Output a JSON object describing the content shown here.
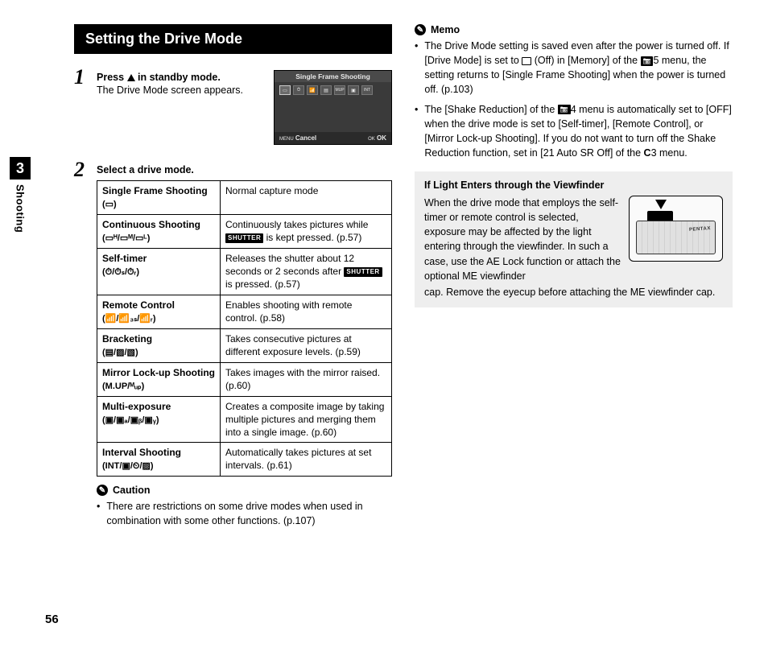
{
  "chapter": {
    "number": "3",
    "label": "Shooting"
  },
  "page_number": "56",
  "section_title": "Setting the Drive Mode",
  "steps": {
    "s1": {
      "num": "1",
      "title_pre": "Press ",
      "title_post": " in standby mode.",
      "desc": "The Drive Mode screen appears."
    },
    "s2": {
      "num": "2",
      "title": "Select a drive mode."
    }
  },
  "lcd": {
    "title": "Single Frame Shooting",
    "cancel_pre": "MENU",
    "cancel": "Cancel",
    "ok_pre": "OK",
    "ok": "OK"
  },
  "modes": [
    {
      "name": "Single Frame Shooting",
      "glyphs": "(▭)",
      "desc": "Normal capture mode"
    },
    {
      "name": "Continuous Shooting",
      "glyphs": "(▭ᴴ/▭ᴹ/▭ᴸ)",
      "desc_pre": "Continuously takes pictures while ",
      "desc_post": " is kept pressed. (p.57)"
    },
    {
      "name": "Self-timer",
      "glyphs": "(⏱/⏱ₛ/⏱ᵣ)",
      "desc_pre": "Releases the shutter about 12 seconds or 2 seconds after ",
      "desc_post": " is pressed. (p.57)"
    },
    {
      "name": "Remote Control",
      "glyphs": "(📶/📶₃ₛ/📶ᵣ)",
      "desc": "Enables shooting with remote control. (p.58)"
    },
    {
      "name": "Bracketing",
      "glyphs": "(▤/▨/▧)",
      "desc": "Takes consecutive pictures at different exposure levels. (p.59)"
    },
    {
      "name": "Mirror Lock-up Shooting",
      "glyphs": "(M.UP/ᴹᵤₚ)",
      "desc": "Takes images with the mirror raised. (p.60)"
    },
    {
      "name": "Multi-exposure",
      "glyphs": "(▣/▣ₐ/▣ᵦ/▣ᵧ)",
      "desc": "Creates a composite image by taking multiple pictures and merging them into a single image. (p.60)"
    },
    {
      "name": "Interval Shooting",
      "glyphs": "(INT/▣/⏲/▨)",
      "desc": "Automatically takes pictures at set intervals. (p.61)"
    }
  ],
  "caution": {
    "label": "Caution",
    "items": [
      "There are restrictions on some drive modes when used in combination with some other functions. (p.107)"
    ]
  },
  "memo": {
    "label": "Memo",
    "items": [
      {
        "pre": "The Drive Mode setting is saved even after the power is turned off. If [Drive Mode] is set to ",
        "mid1": " (Off) in [Memory] of the ",
        "cam1": "5",
        "post1": " menu, the setting returns to [Single Frame Shooting] when the power is turned off. (p.103)"
      },
      {
        "pre": "The [Shake Reduction] of the ",
        "cam1": "4",
        "mid1": " menu is automatically set to [OFF] when the drive mode is set to [Self-timer], [Remote Control], or [Mirror Lock-up Shooting]. If you do not want to turn off the Shake Reduction function, set in [21 Auto SR Off] of the ",
        "c3": "C",
        "c3n": "3",
        "post1": " menu."
      }
    ]
  },
  "infobox": {
    "title": "If Light Enters through the Viewfinder",
    "text1": "When the drive mode that employs the self-timer or remote control is selected, exposure may be affected by the light entering through the viewfinder. In such a case, use the AE Lock function or attach the optional ME viewfinder",
    "text2": "cap. Remove the eyecup before attaching the ME viewfinder cap.",
    "brand": "PENTAX"
  },
  "shutter_label": "SHUTTER"
}
